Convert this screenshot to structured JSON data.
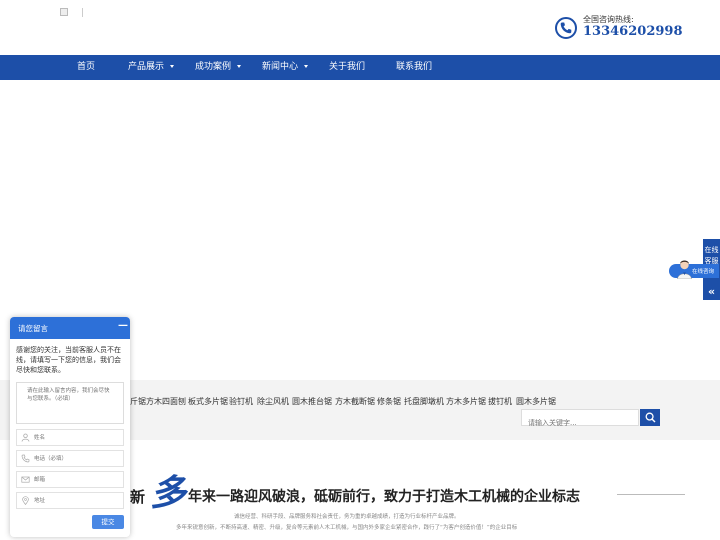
{
  "header": {
    "logo_alt": "",
    "hotline_label": "全国咨询热线:",
    "hotline_number": "13346202998",
    "phone_icon": "phone-icon"
  },
  "nav": {
    "items": [
      {
        "label": "首页",
        "has_dropdown": false
      },
      {
        "label": "产品展示",
        "has_dropdown": true
      },
      {
        "label": "成功案例",
        "has_dropdown": true
      },
      {
        "label": "新闻中心",
        "has_dropdown": true
      },
      {
        "label": "关于我们",
        "has_dropdown": false
      },
      {
        "label": "联系我们",
        "has_dropdown": false
      }
    ]
  },
  "keywords": {
    "items": [
      "斤锯",
      "方木四面刨",
      "板式多片锯",
      "验钉机",
      "除尘风机",
      "圆木推台锯",
      "方木截断锯",
      "修条锯",
      "托盘脚墩机",
      "方木多片锯",
      "拔钉机",
      "圆木多片锯"
    ],
    "search_placeholder": "请输入关键字..."
  },
  "slogan": {
    "prefix": "新",
    "big_char": "多",
    "main": "年来一路迎风破浪，砥砺前行，致力于打造木工机械的企业标志",
    "desc_line1": "诚信经营、科研手段、品牌服务和社会责任，务为重的卓越成绩，打造为行业标杆产业品牌。",
    "desc_line2": "多年来锐意创新，不断持高速、精密、升级，复合等元素前人木工机械，与国内外多家企业紧密合作，践行了“为客户创造价值！”的企业目标"
  },
  "online_service": {
    "tab_text": "在线客服",
    "chevron": "«",
    "bubble_text": "在线咨询"
  },
  "chat": {
    "title": "请您留言",
    "minimize": "—",
    "message": "感谢您的关注，当前客服人员不在线，请填写一下您的信息，我们会尽快和您联系。",
    "textarea_placeholder": "请在此输入留言内容，我们会尽快与您联系。（必填）",
    "fields": [
      {
        "icon": "user-icon",
        "placeholder": "姓名"
      },
      {
        "icon": "phone-icon",
        "placeholder": "电话（必填）"
      },
      {
        "icon": "mail-icon",
        "placeholder": "邮箱"
      },
      {
        "icon": "location-icon",
        "placeholder": "地址"
      }
    ],
    "submit_label": "提交"
  },
  "colors": {
    "brand_blue": "#1d4fa8",
    "chat_blue": "#2d70d8",
    "keyword_bg": "#f3f3f3"
  }
}
